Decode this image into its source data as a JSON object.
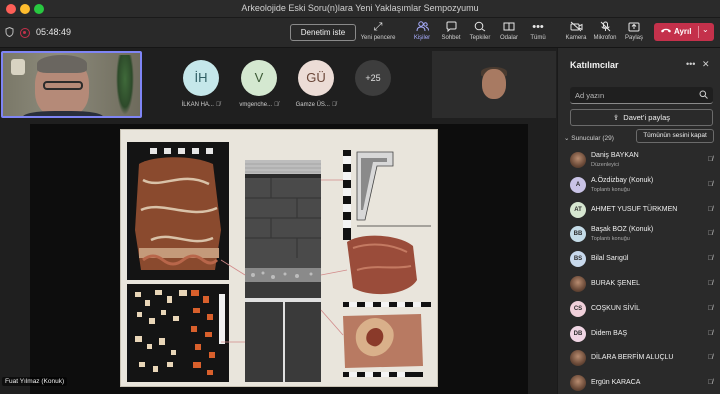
{
  "window": {
    "title": "Arkeolojide Eski Soru(n)lara Yeni Yaklaşımlar Sempozyumu"
  },
  "toolbar": {
    "timer": "05:48:49",
    "action_button": "Denetim iste",
    "items": [
      {
        "label": "Yeni pencere",
        "icon": "new-window-icon"
      },
      {
        "label": "Kişiler",
        "icon": "people-icon"
      },
      {
        "label": "Sohbet",
        "icon": "chat-icon"
      },
      {
        "label": "Tepkiler",
        "icon": "reactions-icon"
      },
      {
        "label": "Odalar",
        "icon": "rooms-icon"
      },
      {
        "label": "Tümü",
        "icon": "more-icon"
      },
      {
        "label": "Kamera",
        "icon": "camera-off-icon"
      },
      {
        "label": "Mikrofon",
        "icon": "mic-off-icon"
      },
      {
        "label": "Paylaş",
        "icon": "share-icon"
      }
    ],
    "leave_label": "Ayrıl"
  },
  "stage": {
    "tiles": [
      {
        "initials": "İH",
        "name": "İLKAN HA...",
        "bg": "#c5e7ea",
        "fg": "#2f5d63"
      },
      {
        "initials": "V",
        "name": "vmgenche...",
        "bg": "#d4e8d0",
        "fg": "#3c5a36"
      },
      {
        "initials": "GÜ",
        "name": "Gamze ÜS...",
        "bg": "#ecdcd6",
        "fg": "#6a4638"
      }
    ],
    "more_count": "+25",
    "presenter_name": "Fuat Yılmaz (Konuk)"
  },
  "panel": {
    "title": "Katılımcılar",
    "search_placeholder": "Ad yazın",
    "invite_label": "Davet’i paylaş",
    "section_label": "Sunucular (29)",
    "mute_all_label": "Tümünün sesini kapat",
    "participants": [
      {
        "initials": "",
        "name": "Daniş BAYKAN",
        "role": "Düzenleyici",
        "photo": true,
        "bg": ""
      },
      {
        "initials": "A",
        "name": "A.Özdizbay (Konuk)",
        "role": "Toplantı konuğu",
        "photo": false,
        "bg": "#c9c3e6"
      },
      {
        "initials": "AT",
        "name": "AHMET YUSUF TÜRKMEN",
        "role": "",
        "photo": false,
        "bg": "#d6e6d0"
      },
      {
        "initials": "BB",
        "name": "Başak BOZ (Konuk)",
        "role": "Toplantı konuğu",
        "photo": false,
        "bg": "#c5dce8"
      },
      {
        "initials": "BS",
        "name": "Bilal Sarıgül",
        "role": "",
        "photo": false,
        "bg": "#c8d9ec"
      },
      {
        "initials": "",
        "name": "BURAK ŞENEL",
        "role": "",
        "photo": true,
        "bg": ""
      },
      {
        "initials": "CS",
        "name": "COŞKUN SİVİL",
        "role": "",
        "photo": false,
        "bg": "#f0d0da"
      },
      {
        "initials": "DB",
        "name": "Didem BAŞ",
        "role": "",
        "photo": false,
        "bg": "#f0d6e4"
      },
      {
        "initials": "",
        "name": "DİLARA BERFİM ALUÇLU",
        "role": "",
        "photo": true,
        "bg": ""
      },
      {
        "initials": "",
        "name": "Ergün KARACA",
        "role": "",
        "photo": true,
        "bg": ""
      }
    ]
  }
}
